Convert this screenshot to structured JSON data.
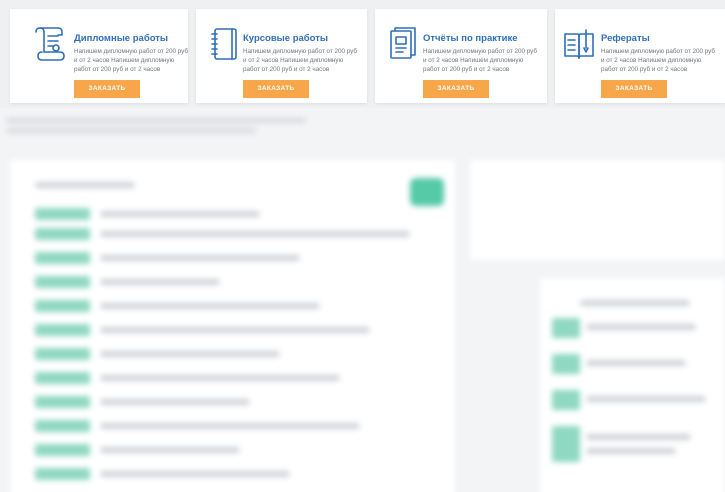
{
  "services": [
    {
      "title": "Дипломные работы",
      "description": "Напишем дипломную работ от 200 руб и от 2 часов Напишем дипломную работ от 200 руб и от 2 часов",
      "button": "ЗАКАЗАТЬ",
      "icon": "diploma-scroll-icon"
    },
    {
      "title": "Курсовые работы",
      "description": "Напишем дипломную работ от 200 руб и от 2 часов Напишем дипломную работ от 200 руб и от 2 часов",
      "button": "ЗАКАЗАТЬ",
      "icon": "notebook-icon"
    },
    {
      "title": "Отчёты по практике",
      "description": "Напишем дипломную работ от 200 руб и от 2 часов Напишем дипломную работ от 200 руб и от 2 часов",
      "button": "ЗАКАЗАТЬ",
      "icon": "report-folder-icon"
    },
    {
      "title": "Рефераты",
      "description": "Напишем дипломную работ от 200 руб и от 2 часов Напишем дипломную работ от 200 руб и от 2 часов",
      "button": "ЗАКАЗАТЬ",
      "icon": "essay-book-icon"
    }
  ],
  "colors": {
    "title": "#2f6fb8",
    "button": "#f7a64a",
    "icon": "#2f6fb8",
    "blurred_accent": "#56c9a6"
  }
}
